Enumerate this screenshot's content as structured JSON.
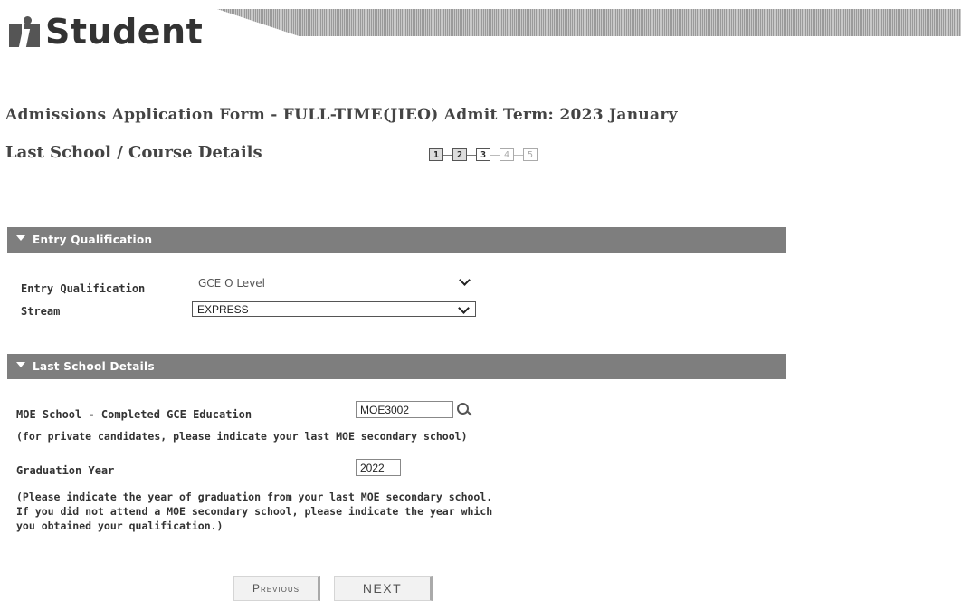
{
  "header": {
    "logo_text": "Student",
    "form_title": "Admissions Application Form - FULL-TIME(JIEO)   Admit Term: 2023 January",
    "page_title": "Last School / Course Details"
  },
  "steps": [
    {
      "label": "1",
      "state": "done"
    },
    {
      "label": "2",
      "state": "done"
    },
    {
      "label": "3",
      "state": "current"
    },
    {
      "label": "4",
      "state": "todo"
    },
    {
      "label": "5",
      "state": "todo"
    }
  ],
  "entry_section": {
    "title": "Entry Qualification",
    "qualification_label": "Entry Qualification",
    "qualification_value": "GCE O Level",
    "stream_label": "Stream",
    "stream_value": "EXPRESS"
  },
  "school_section": {
    "title": "Last School Details",
    "moe_label": "MOE School - Completed GCE Education",
    "moe_value": "MOE3002",
    "moe_note": "(for private candidates, please indicate your last MOE secondary school)",
    "grad_label": "Graduation Year",
    "grad_value": "2022",
    "grad_note_1": "(Please indicate the year of graduation from your last MOE secondary school.",
    "grad_note_2": "If you did not attend a MOE secondary school, please indicate the year which",
    "grad_note_3": "you obtained your qualification.)"
  },
  "buttons": {
    "previous": "Previous",
    "next": "NEXT"
  },
  "colors": {
    "section_bar": "#7e7e7e",
    "text": "#333333"
  }
}
